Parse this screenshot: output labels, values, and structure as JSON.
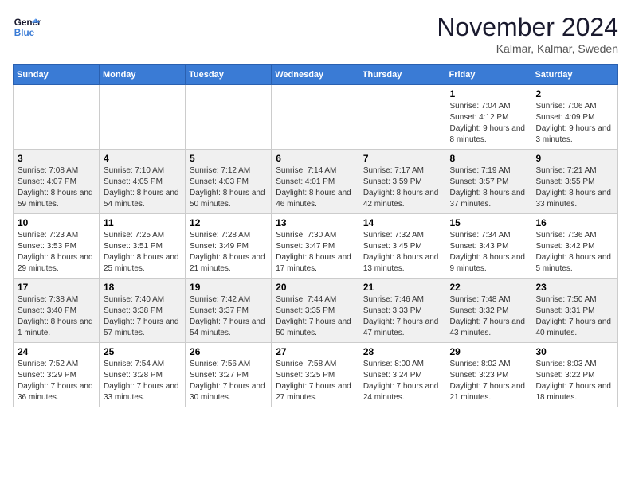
{
  "logo": {
    "line1": "General",
    "line2": "Blue"
  },
  "title": "November 2024",
  "location": "Kalmar, Kalmar, Sweden",
  "weekdays": [
    "Sunday",
    "Monday",
    "Tuesday",
    "Wednesday",
    "Thursday",
    "Friday",
    "Saturday"
  ],
  "weeks": [
    [
      {
        "day": "",
        "info": ""
      },
      {
        "day": "",
        "info": ""
      },
      {
        "day": "",
        "info": ""
      },
      {
        "day": "",
        "info": ""
      },
      {
        "day": "",
        "info": ""
      },
      {
        "day": "1",
        "info": "Sunrise: 7:04 AM\nSunset: 4:12 PM\nDaylight: 9 hours and 8 minutes."
      },
      {
        "day": "2",
        "info": "Sunrise: 7:06 AM\nSunset: 4:09 PM\nDaylight: 9 hours and 3 minutes."
      }
    ],
    [
      {
        "day": "3",
        "info": "Sunrise: 7:08 AM\nSunset: 4:07 PM\nDaylight: 8 hours and 59 minutes."
      },
      {
        "day": "4",
        "info": "Sunrise: 7:10 AM\nSunset: 4:05 PM\nDaylight: 8 hours and 54 minutes."
      },
      {
        "day": "5",
        "info": "Sunrise: 7:12 AM\nSunset: 4:03 PM\nDaylight: 8 hours and 50 minutes."
      },
      {
        "day": "6",
        "info": "Sunrise: 7:14 AM\nSunset: 4:01 PM\nDaylight: 8 hours and 46 minutes."
      },
      {
        "day": "7",
        "info": "Sunrise: 7:17 AM\nSunset: 3:59 PM\nDaylight: 8 hours and 42 minutes."
      },
      {
        "day": "8",
        "info": "Sunrise: 7:19 AM\nSunset: 3:57 PM\nDaylight: 8 hours and 37 minutes."
      },
      {
        "day": "9",
        "info": "Sunrise: 7:21 AM\nSunset: 3:55 PM\nDaylight: 8 hours and 33 minutes."
      }
    ],
    [
      {
        "day": "10",
        "info": "Sunrise: 7:23 AM\nSunset: 3:53 PM\nDaylight: 8 hours and 29 minutes."
      },
      {
        "day": "11",
        "info": "Sunrise: 7:25 AM\nSunset: 3:51 PM\nDaylight: 8 hours and 25 minutes."
      },
      {
        "day": "12",
        "info": "Sunrise: 7:28 AM\nSunset: 3:49 PM\nDaylight: 8 hours and 21 minutes."
      },
      {
        "day": "13",
        "info": "Sunrise: 7:30 AM\nSunset: 3:47 PM\nDaylight: 8 hours and 17 minutes."
      },
      {
        "day": "14",
        "info": "Sunrise: 7:32 AM\nSunset: 3:45 PM\nDaylight: 8 hours and 13 minutes."
      },
      {
        "day": "15",
        "info": "Sunrise: 7:34 AM\nSunset: 3:43 PM\nDaylight: 8 hours and 9 minutes."
      },
      {
        "day": "16",
        "info": "Sunrise: 7:36 AM\nSunset: 3:42 PM\nDaylight: 8 hours and 5 minutes."
      }
    ],
    [
      {
        "day": "17",
        "info": "Sunrise: 7:38 AM\nSunset: 3:40 PM\nDaylight: 8 hours and 1 minute."
      },
      {
        "day": "18",
        "info": "Sunrise: 7:40 AM\nSunset: 3:38 PM\nDaylight: 7 hours and 57 minutes."
      },
      {
        "day": "19",
        "info": "Sunrise: 7:42 AM\nSunset: 3:37 PM\nDaylight: 7 hours and 54 minutes."
      },
      {
        "day": "20",
        "info": "Sunrise: 7:44 AM\nSunset: 3:35 PM\nDaylight: 7 hours and 50 minutes."
      },
      {
        "day": "21",
        "info": "Sunrise: 7:46 AM\nSunset: 3:33 PM\nDaylight: 7 hours and 47 minutes."
      },
      {
        "day": "22",
        "info": "Sunrise: 7:48 AM\nSunset: 3:32 PM\nDaylight: 7 hours and 43 minutes."
      },
      {
        "day": "23",
        "info": "Sunrise: 7:50 AM\nSunset: 3:31 PM\nDaylight: 7 hours and 40 minutes."
      }
    ],
    [
      {
        "day": "24",
        "info": "Sunrise: 7:52 AM\nSunset: 3:29 PM\nDaylight: 7 hours and 36 minutes."
      },
      {
        "day": "25",
        "info": "Sunrise: 7:54 AM\nSunset: 3:28 PM\nDaylight: 7 hours and 33 minutes."
      },
      {
        "day": "26",
        "info": "Sunrise: 7:56 AM\nSunset: 3:27 PM\nDaylight: 7 hours and 30 minutes."
      },
      {
        "day": "27",
        "info": "Sunrise: 7:58 AM\nSunset: 3:25 PM\nDaylight: 7 hours and 27 minutes."
      },
      {
        "day": "28",
        "info": "Sunrise: 8:00 AM\nSunset: 3:24 PM\nDaylight: 7 hours and 24 minutes."
      },
      {
        "day": "29",
        "info": "Sunrise: 8:02 AM\nSunset: 3:23 PM\nDaylight: 7 hours and 21 minutes."
      },
      {
        "day": "30",
        "info": "Sunrise: 8:03 AM\nSunset: 3:22 PM\nDaylight: 7 hours and 18 minutes."
      }
    ]
  ]
}
